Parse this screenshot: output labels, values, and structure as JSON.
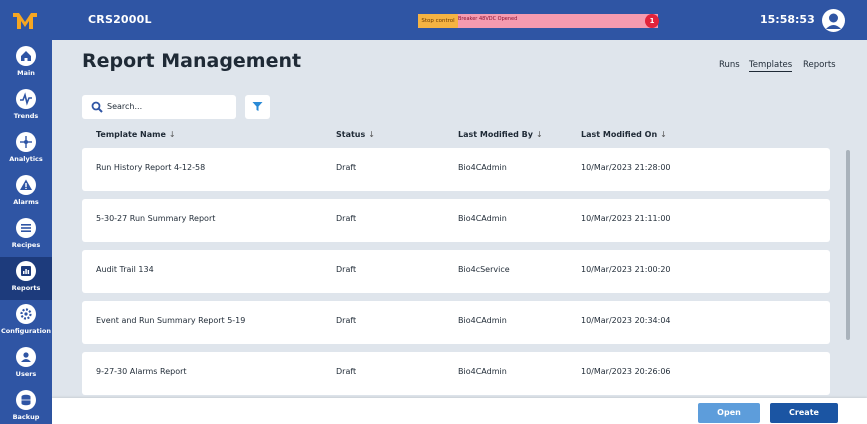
{
  "header": {
    "app_title": "CRS2000L",
    "clock": "15:58:53",
    "alarm": {
      "stop_label": "Stop control",
      "message": "Breaker 48VDC Opened",
      "count": "1"
    }
  },
  "sidebar": {
    "items": [
      {
        "label": "Main",
        "icon": "home-icon"
      },
      {
        "label": "Trends",
        "icon": "trends-icon"
      },
      {
        "label": "Analytics",
        "icon": "analytics-icon"
      },
      {
        "label": "Alarms",
        "icon": "alarm-icon"
      },
      {
        "label": "Recipes",
        "icon": "recipes-icon"
      },
      {
        "label": "Reports",
        "icon": "reports-icon",
        "active": true
      },
      {
        "label": "Configuration",
        "icon": "configuration-icon"
      },
      {
        "label": "Users",
        "icon": "users-icon"
      },
      {
        "label": "Backup",
        "icon": "backup-icon"
      }
    ]
  },
  "main": {
    "title": "Report Management",
    "tabs": [
      {
        "label": "Runs"
      },
      {
        "label": "Templates",
        "active": true
      },
      {
        "label": "Reports"
      }
    ],
    "search_placeholder": "Search...",
    "columns": [
      "Template Name",
      "Status",
      "Last Modified By",
      "Last Modified On"
    ],
    "rows": [
      [
        "Run History Report 4-12-58",
        "Draft",
        "Bio4CAdmin",
        "10/Mar/2023 21:28:00"
      ],
      [
        "5-30-27 Run Summary Report",
        "Draft",
        "Bio4CAdmin",
        "10/Mar/2023 21:11:00"
      ],
      [
        "Audit Trail 134",
        "Draft",
        "Bio4cService",
        "10/Mar/2023 21:00:20"
      ],
      [
        "Event and Run Summary Report 5-19",
        "Draft",
        "Bio4CAdmin",
        "10/Mar/2023 20:34:04"
      ],
      [
        "9-27-30 Alarms Report",
        "Draft",
        "Bio4CAdmin",
        "10/Mar/2023 20:26:06"
      ]
    ]
  },
  "footer": {
    "open_label": "Open",
    "create_label": "Create"
  },
  "colors": {
    "brand": "#2f55a4",
    "accent_dark": "#1b55a3",
    "accent_light": "#5d9ddb",
    "logo": "#f5a623",
    "alarm_bg": "#f59bb0"
  }
}
